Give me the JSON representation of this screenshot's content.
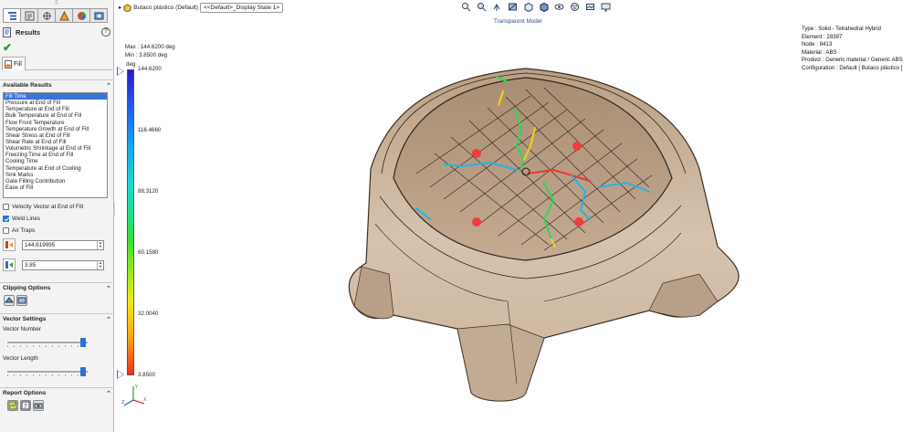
{
  "panel": {
    "title": "Results",
    "help": "?",
    "fill_tab": "Fill",
    "available_results": {
      "title": "Available Results",
      "items": [
        "Fill Time",
        "Pressure at End of Fill",
        "Temperature at End of Fill",
        "Bulk Temperature at End of Fill",
        "Flow Front Temperature",
        "Temperature Growth at End of Fill",
        "Shear Stress at End of Fill",
        "Shear Rate at End of Fill",
        "Volumetric Shrinkage at End of Fill",
        "Freezing Time at End of Fill",
        "Cooling Time",
        "Temperature at End of Cooling",
        "Sink Marks",
        "Gate Filling Contribution",
        "Ease of Fill"
      ],
      "selected": "Fill Time"
    },
    "velocity_vector": "Velocity Vector at End of Fill",
    "weld_lines": "Weld Lines",
    "air_traps": "Air Traps",
    "max_value": "144.619995",
    "min_value": "3.85",
    "clipping_options": "Clipping Options",
    "vector_settings": "Vector Settings",
    "vector_number": "Vector Number",
    "vector_number_level": 0.97,
    "vector_length": "Vector Length",
    "vector_length_level": 0.97,
    "report_options": "Report Options"
  },
  "viewport": {
    "doc_name": "Butaco plástico (Default)",
    "display_state": "<<Default>_Display State 1>",
    "view_title": "Transparent Model",
    "legend": {
      "max_label": "Max : 144.6200 deg",
      "min_label": "Min : 3.8500 deg",
      "unit": "deg",
      "ticks": [
        "144.6200",
        "116.4660",
        "88.3120",
        "60.1580",
        "32.0040",
        "3.8500"
      ]
    },
    "info": {
      "type": "Type : Solid - Tetrahedral Hybrid",
      "element": "Element : 28397",
      "node": "Node : 8413",
      "material": "Material : ABS",
      "product": "Product : Generic material / Generic ABS",
      "configuration": "Configuration : Default [ Butaco plástico ]"
    },
    "triad": {
      "x": "X",
      "y": "Y",
      "z": "Z"
    }
  },
  "colors": {
    "selection": "#3875d7",
    "accent": "#2a72d4",
    "model_fill": "#c9b29a",
    "model_edge": "#3a2d22"
  }
}
